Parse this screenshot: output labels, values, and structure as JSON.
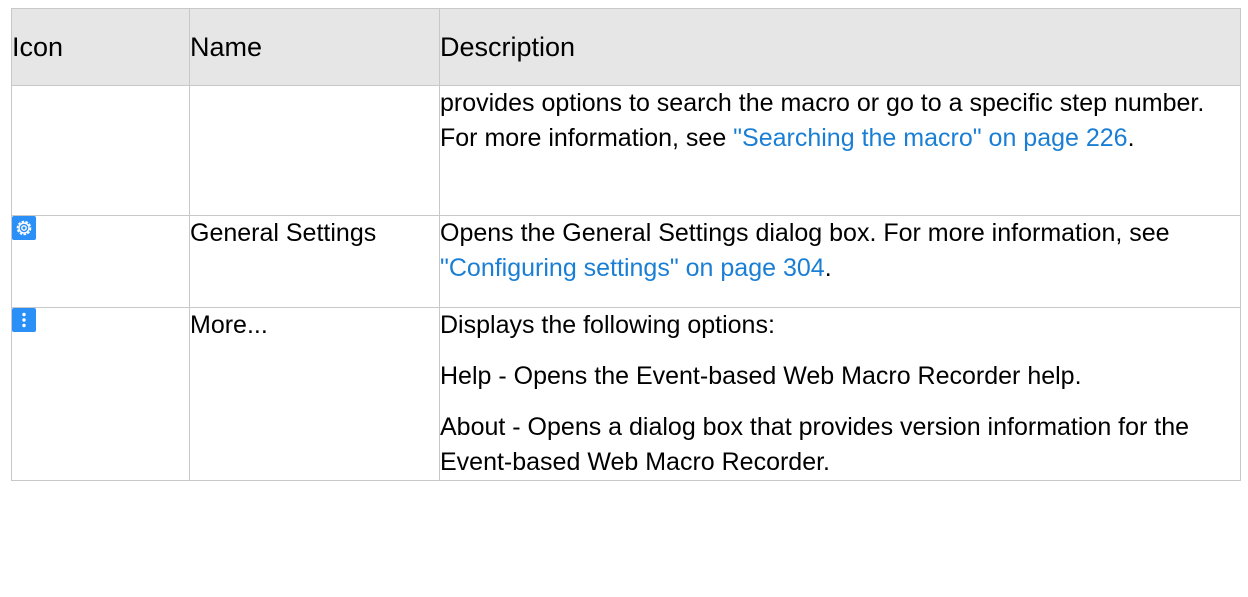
{
  "table": {
    "headers": {
      "icon": "Icon",
      "name": "Name",
      "description": "Description"
    },
    "rows": [
      {
        "icon": "",
        "name": "",
        "description": {
          "text": "provides options to search the macro or go to a specific step number. For more information, see ",
          "link": "\"Searching the macro\" on page 226",
          "end": "."
        }
      },
      {
        "icon": "gear-icon",
        "name": "General Settings",
        "description": {
          "text": "Opens the General Settings dialog box. For more information, see ",
          "link": "\"Configuring settings\" on page 304",
          "end": "."
        }
      },
      {
        "icon": "more-vertical-icon",
        "name": "More...",
        "description": {
          "intro": "Displays the following options:",
          "options": [
            {
              "term": "Help",
              "text": " - Opens the Event-based Web Macro Recorder help."
            },
            {
              "term": "About",
              "text": " - Opens a dialog box that provides version information for the Event-based Web Macro Recorder."
            }
          ]
        }
      }
    ]
  },
  "colors": {
    "link": "#1a7fd4",
    "icon_background": "#2a8ff7",
    "header_background": "#e6e6e6",
    "border": "#c8c8c8"
  }
}
